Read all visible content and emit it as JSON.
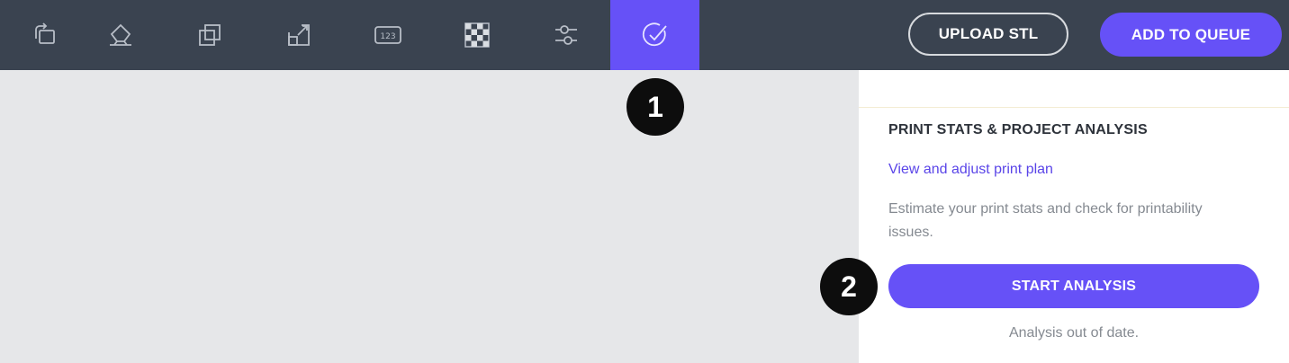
{
  "toolbar": {
    "tools": [
      {
        "icon": "rotate-icon"
      },
      {
        "icon": "lay-flat-icon"
      },
      {
        "icon": "duplicate-icon"
      },
      {
        "icon": "scale-icon"
      },
      {
        "icon": "number-icon",
        "label": "123"
      },
      {
        "icon": "checkerboard-icon"
      },
      {
        "icon": "sliders-icon"
      },
      {
        "icon": "analysis-check-icon",
        "active": true
      }
    ],
    "upload_label": "UPLOAD STL",
    "queue_label": "ADD TO QUEUE"
  },
  "panel": {
    "title": "PRINT STATS & PROJECT ANALYSIS",
    "link": "View and adjust print plan",
    "description": "Estimate your print stats and check for printability issues.",
    "button_label": "START ANALYSIS",
    "status": "Analysis out of date."
  },
  "callouts": {
    "first": "1",
    "second": "2"
  },
  "colors": {
    "toolbar_bg": "#3a4350",
    "accent": "#6651f7",
    "canvas_bg": "#e6e7e9"
  }
}
